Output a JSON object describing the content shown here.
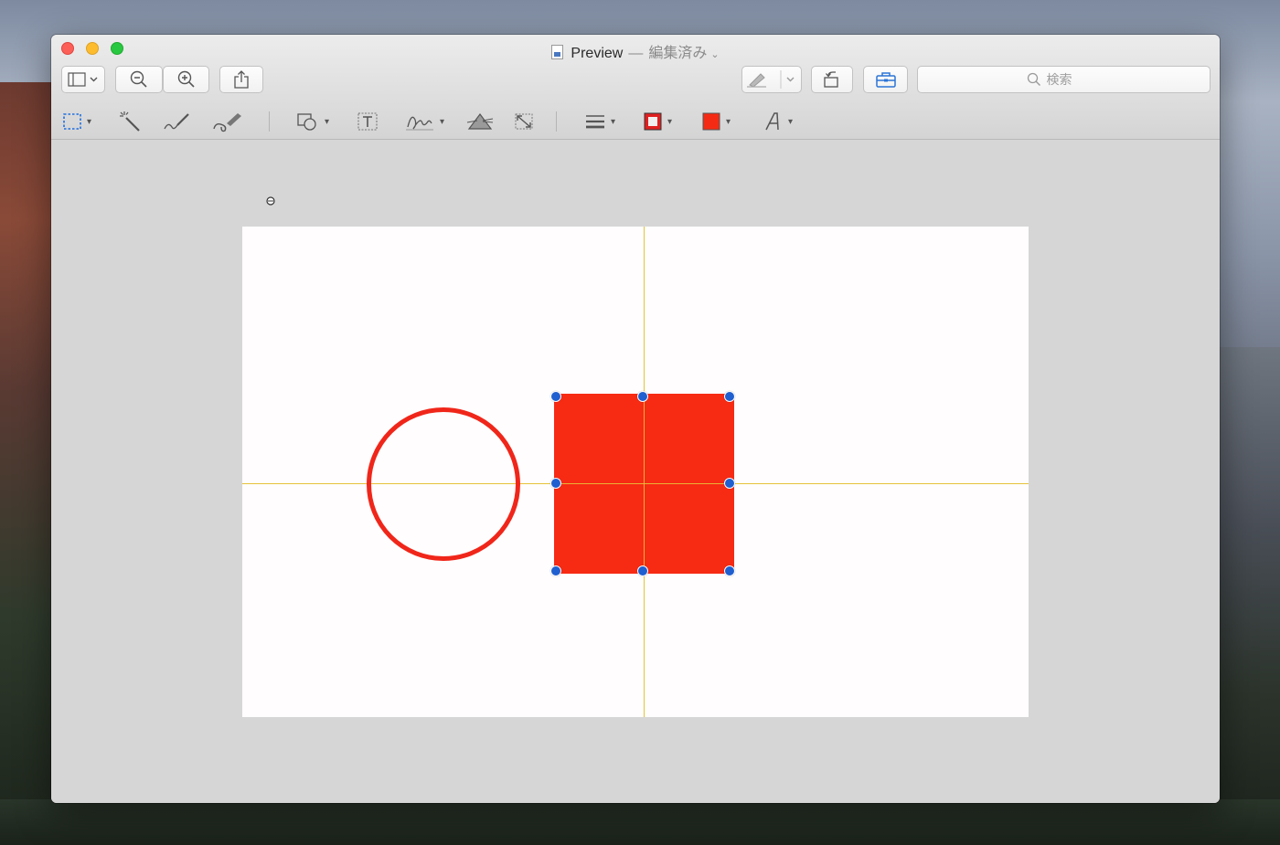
{
  "window": {
    "title": "Preview",
    "separator": "—",
    "status": "編集済み"
  },
  "toolbar": {
    "search": {
      "placeholder": "検索"
    }
  },
  "icons": {
    "sidebar": "sidebar-icon",
    "zoom_out": "zoom-out-icon",
    "zoom_in": "zoom-in-icon",
    "share": "share-icon",
    "markup_pen": "pen-icon",
    "rotate": "rotate-icon",
    "toolbox": "toolbox-icon",
    "search": "search-icon"
  },
  "markup": {
    "tools": [
      "rectangular-selection",
      "instant-alpha",
      "sketch",
      "draw",
      "shapes",
      "text",
      "sign",
      "adjust-color",
      "adjust-size",
      "shape-style",
      "border-color",
      "fill-color",
      "text-style"
    ],
    "border_color": "#e02020",
    "fill_color": "#f52a14"
  },
  "document": {
    "circle_stroke": "#f0261a",
    "square_fill": "#f72a14",
    "guide_color": "#e6c23a",
    "handle_color": "#1f5fd0"
  }
}
